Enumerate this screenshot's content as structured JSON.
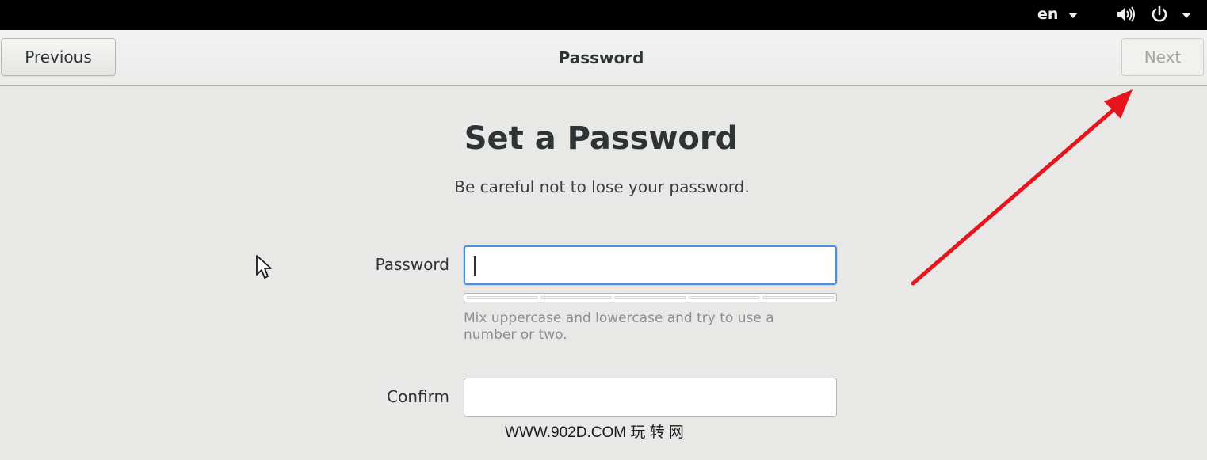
{
  "topbar": {
    "language": "en",
    "icons": [
      "volume-icon",
      "power-icon",
      "chevron-down-icon"
    ]
  },
  "header": {
    "previous_label": "Previous",
    "title": "Password",
    "next_label": "Next",
    "next_enabled": false
  },
  "main": {
    "title": "Set a Password",
    "subtitle": "Be careful not to lose your password.",
    "password_label": "Password",
    "password_value": "",
    "strength_segments": 5,
    "strength_level": 0,
    "hint": "Mix uppercase and lowercase and try to use a number or two.",
    "confirm_label": "Confirm",
    "confirm_value": ""
  },
  "overlay": {
    "watermark": "WWW.902D.COM 玩 转 网",
    "annotation_color": "#e8141b"
  },
  "colors": {
    "focus_accent": "#4a90d9",
    "topbar_bg": "#000000",
    "window_bg": "#e8e8e7"
  }
}
